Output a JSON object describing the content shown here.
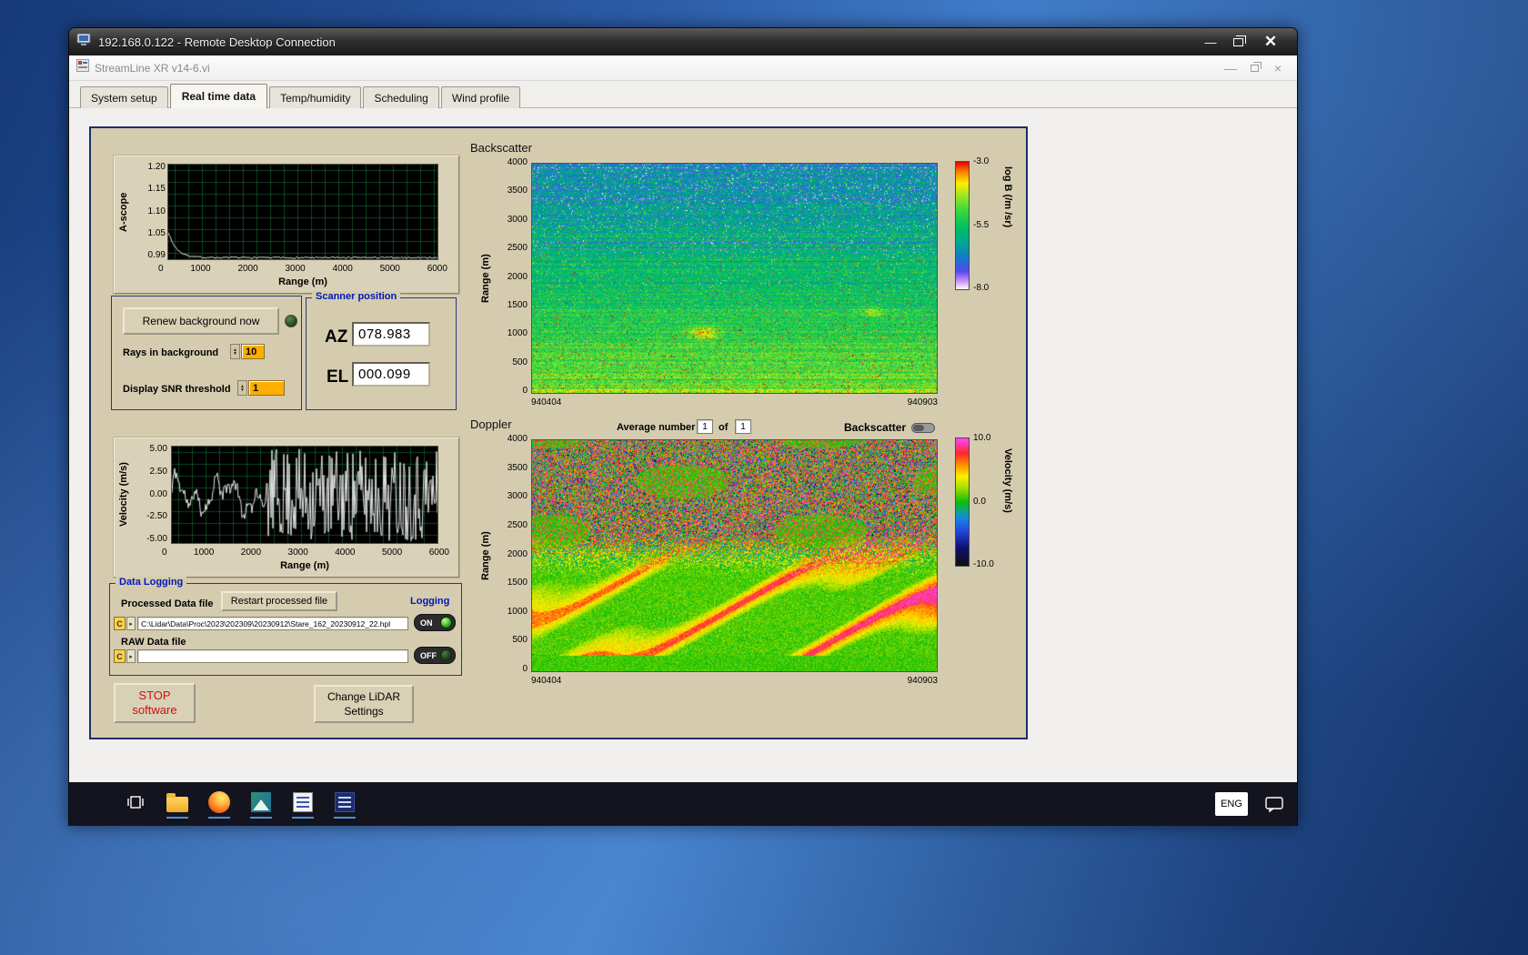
{
  "rdc": {
    "title": "192.168.0.122 - Remote Desktop Connection"
  },
  "app": {
    "title": "StreamLine XR v14-6.vi",
    "tabs": [
      {
        "label": "System setup"
      },
      {
        "label": "Real time data"
      },
      {
        "label": "Temp/humidity"
      },
      {
        "label": "Scheduling"
      },
      {
        "label": "Wind profile"
      }
    ],
    "active_tab": "Real time data"
  },
  "background_controls": {
    "renew_button": "Renew background now",
    "rays_label": "Rays in background",
    "rays_value": "10",
    "snr_label": "Display SNR threshold",
    "snr_value": "1"
  },
  "scanner_position": {
    "box_label": "Scanner position",
    "az_label": "AZ",
    "az_value": "078.983",
    "el_label": "EL",
    "el_value": "000.099"
  },
  "doppler_header": {
    "average_label": "Average number",
    "average_value": "1",
    "of_label": "of",
    "average_total": "1",
    "backscatter_toggle_label": "Backscatter"
  },
  "data_logging": {
    "box_label": "Data Logging",
    "processed_label": "Processed Data file",
    "restart_button": "Restart processed file",
    "logging_label": "Logging",
    "processed_path": "C:\\Lidar\\Data\\Proc\\2023\\202309\\20230912\\Stare_162_20230912_22.hpl",
    "on_label": "ON",
    "raw_label": "RAW Data file",
    "raw_path": "",
    "off_label": "OFF"
  },
  "action_buttons": {
    "stop_line1": "STOP",
    "stop_line2": "software",
    "change_line1": "Change LiDAR",
    "change_line2": "Settings"
  },
  "taskbar": {
    "language": "ENG"
  },
  "chart_data": [
    {
      "id": "ascope",
      "type": "line",
      "ylabel": "A-scope",
      "xlabel": "Range (m)",
      "ylim": [
        0.99,
        1.2
      ],
      "xlim": [
        0,
        6000
      ],
      "yticks": [
        "1.20",
        "1.15",
        "1.10",
        "1.05",
        "0.99"
      ],
      "xticks": [
        "0",
        "1000",
        "2000",
        "3000",
        "4000",
        "5000",
        "6000"
      ],
      "grid": true,
      "series": [
        {
          "name": "a-scope signal",
          "summary": "starts at about 1.05 at range 0, decays to about 0.99 by 700 m, then stays flat near 0.992 with small noise out to 6000 m"
        }
      ]
    },
    {
      "id": "velocity",
      "type": "line",
      "ylabel": "Velocity (m/s)",
      "xlabel": "Range (m)",
      "ylim": [
        -5,
        5
      ],
      "xlim": [
        0,
        6000
      ],
      "yticks": [
        "5.00",
        "2.50",
        "0.00",
        "-2.50",
        "-5.00"
      ],
      "xticks": [
        "0",
        "1000",
        "2000",
        "3000",
        "4000",
        "5000",
        "6000"
      ],
      "grid": true,
      "series": [
        {
          "name": "radial velocity",
          "summary": "wanders around 0 within about ±2.5 m/s below ~2200 m, then becomes saturated full-scale noise between -5 and +5 m/s out to 6000 m"
        }
      ]
    },
    {
      "id": "backscatter",
      "type": "heatmap",
      "title": "Backscatter",
      "ylabel": "Range (m)",
      "ylim": [
        0,
        4000
      ],
      "yticks": [
        "4000",
        "3500",
        "3000",
        "2500",
        "2000",
        "1500",
        "1000",
        "500",
        "0"
      ],
      "x_start_label": "940404",
      "x_end_label": "940903",
      "colorbar": {
        "label": "log B (/m /sr)",
        "ticks": [
          "-3.0",
          "-5.5",
          "-8.0"
        ],
        "min": -8,
        "max": -3
      },
      "summary": "teal-green speckle field; brighter green near the ground, darker blue-green aloft with horizontal stripe artifacts; bright aerosol plume near mid-time at about 1000 m and a fainter one at about 1400 m"
    },
    {
      "id": "doppler",
      "type": "heatmap",
      "title": "Doppler",
      "ylabel": "Range (m)",
      "ylim": [
        0,
        4000
      ],
      "yticks": [
        "4000",
        "3500",
        "3000",
        "2500",
        "2000",
        "1500",
        "1000",
        "500",
        "0"
      ],
      "x_start_label": "940404",
      "x_end_label": "940903",
      "colorbar": {
        "label": "Velocity (m/s)",
        "ticks": [
          "10.0",
          "0.0",
          "-10.0"
        ],
        "min": -10,
        "max": 10
      },
      "summary": "random magenta/green/blue noise above about 2000 m; coherent diagonal yellow-orange-red bands rising left-to-right below; low-velocity green air near the ground"
    }
  ]
}
